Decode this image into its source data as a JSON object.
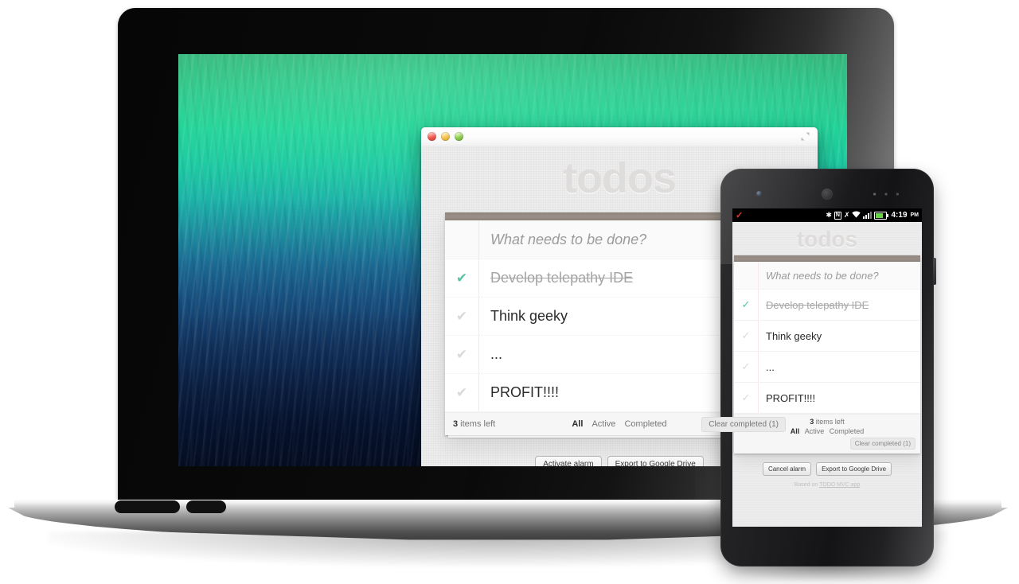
{
  "window": {
    "traffic_lights": [
      "close",
      "minimize",
      "zoom"
    ],
    "fullscreen_icon": "fullscreen-arrows-icon"
  },
  "app": {
    "title": "todos",
    "new_todo_placeholder": "What needs to be done?",
    "items": [
      {
        "label": "Develop telepathy IDE",
        "completed": true
      },
      {
        "label": "Think geeky",
        "completed": false
      },
      {
        "label": "...",
        "completed": false
      },
      {
        "label": "PROFIT!!!!",
        "completed": false
      }
    ],
    "footer": {
      "count_number": "3",
      "count_text": " items left",
      "filters": [
        {
          "label": "All",
          "selected": true
        },
        {
          "label": "Active",
          "selected": false
        },
        {
          "label": "Completed",
          "selected": false
        }
      ],
      "clear_completed": "Clear completed (1)"
    },
    "desktop_actions": {
      "alarm_button": "Activate alarm",
      "export_button": "Export to Google Drive"
    },
    "mobile_actions": {
      "alarm_button": "Cancel alarm",
      "export_button": "Export to Google Drive"
    },
    "credit": {
      "prefix": "Based on ",
      "link": "TODO MVC app"
    }
  },
  "phone": {
    "status_bar": {
      "notification_icon": "red-check-icon",
      "icons": [
        "bluetooth-icon",
        "nfc-icon",
        "silent-mode-icon",
        "wifi-icon",
        "signal-bars-icon",
        "battery-icon"
      ],
      "time": "4:19",
      "ampm": "PM"
    }
  },
  "colors": {
    "accent_green": "#5dc2a3",
    "toggle_bar": "#8f857d",
    "title_gray": "#dedbdb",
    "battery_green": "#6bd04a",
    "notification_red": "#d83b30"
  }
}
